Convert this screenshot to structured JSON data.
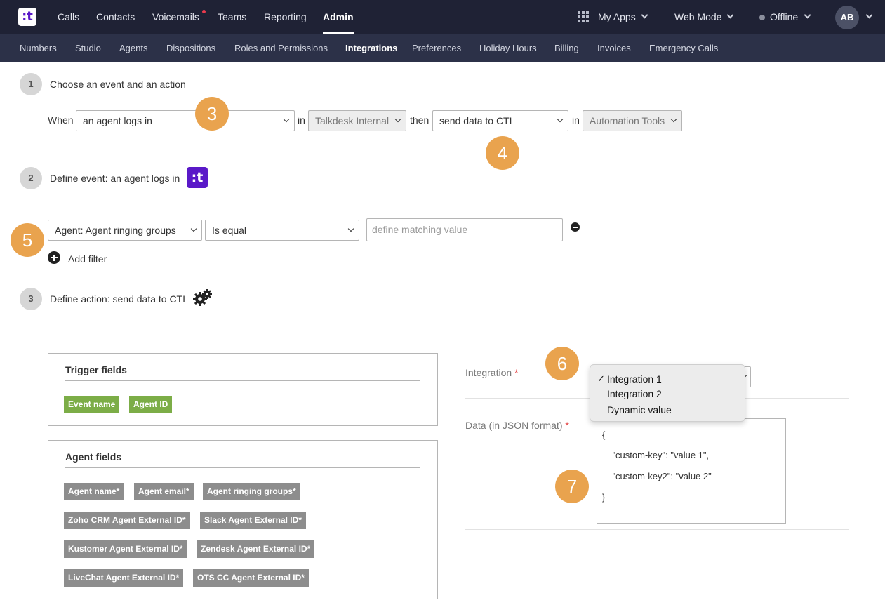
{
  "topnav": {
    "logo": ":t",
    "items": [
      "Calls",
      "Contacts",
      "Voicemails",
      "Teams",
      "Reporting",
      "Admin"
    ],
    "active": "Admin",
    "my_apps": "My Apps",
    "web_mode": "Web Mode",
    "status": "Offline",
    "avatar_initials": "AB"
  },
  "subnav": {
    "items": [
      "Numbers",
      "Studio",
      "Agents",
      "Dispositions",
      "Roles and Permissions",
      "Integrations",
      "Preferences",
      "Holiday Hours",
      "Billing",
      "Invoices",
      "Emergency Calls"
    ],
    "active": "Integrations"
  },
  "step1": {
    "number": "1",
    "title": "Choose an event and an action",
    "when_label": "When",
    "event_value": "an agent logs in",
    "in_label": "in",
    "event_source": "Talkdesk Internal",
    "then_label": "then",
    "action_value": "send data to CTI",
    "in_label_2": "in",
    "action_source": "Automation Tools"
  },
  "step2": {
    "number": "2",
    "title": "Define event: an agent logs in",
    "icon_text": ":t",
    "filter_field": "Agent: Agent ringing groups",
    "filter_operator": "Is equal",
    "filter_placeholder": "define matching value",
    "add_filter": "Add filter"
  },
  "step3": {
    "number": "3",
    "title": "Define action: send data to CTI"
  },
  "callouts": [
    "3",
    "4",
    "5",
    "6",
    "7"
  ],
  "trigger_fields": {
    "title": "Trigger fields",
    "tags": [
      "Event name",
      "Agent ID"
    ]
  },
  "agent_fields": {
    "title": "Agent fields",
    "tags": [
      "Agent name*",
      "Agent email*",
      "Agent ringing groups*",
      "Zoho CRM Agent External ID*",
      "Slack Agent External ID*",
      "Kustomer Agent External ID*",
      "Zendesk Agent External ID*",
      "LiveChat Agent External ID*",
      "OTS CC Agent External ID*"
    ]
  },
  "integration": {
    "label": "Integration",
    "required": "*",
    "options": [
      "Integration 1",
      "Integration 2",
      "Dynamic value"
    ],
    "checkmark": "✓"
  },
  "data_json": {
    "label": "Data (in JSON format)",
    "required": "*",
    "lines": [
      "{",
      "    \"custom-key\": \"value 1\",",
      "    \"custom-key2\": \"value 2\"",
      "}"
    ]
  },
  "colors": {
    "topbar": "#1f2235",
    "subbar": "#2c3148",
    "brand": "#5a19c8",
    "callout": "#e9a34e",
    "tag_green": "#7cad47",
    "tag_grey": "#8d8d8d"
  }
}
